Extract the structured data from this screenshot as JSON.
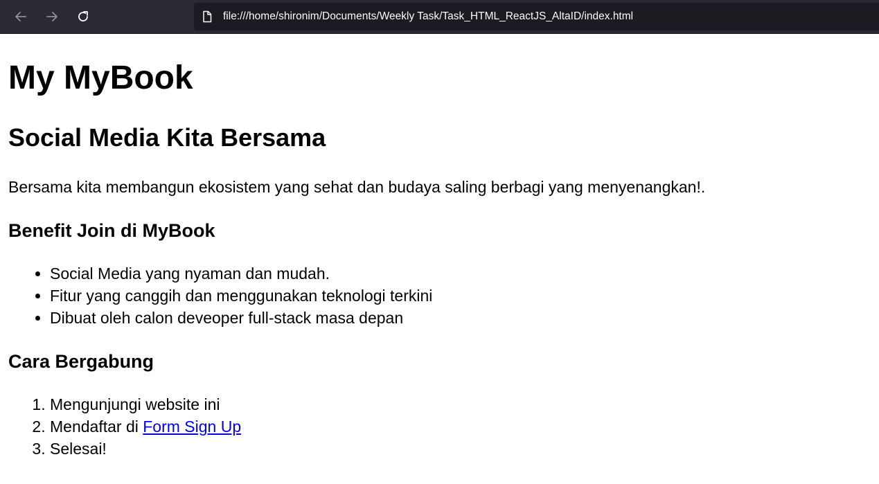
{
  "browser": {
    "url": "file:///home/shironim/Documents/Weekly Task/Task_HTML_ReactJS_AltaID/index.html",
    "icons": [
      "back-arrow-icon",
      "forward-arrow-icon",
      "reload-icon",
      "file-icon"
    ],
    "colors": {
      "toolbar_bg": "#2b2a33",
      "urlbar_bg": "#1c1b22",
      "url_text": "#fbfbfe",
      "icon_disabled": "#8f8f9d",
      "icon_enabled": "#fbfbfe"
    }
  },
  "page": {
    "title": "My MyBook",
    "tagline": "Social Media Kita Bersama",
    "intro": "Bersama kita membangun ekosistem yang sehat dan budaya saling berbagi yang menyenangkan!.",
    "benefits": {
      "heading": "Benefit Join di MyBook",
      "items": [
        "Social Media yang nyaman dan mudah.",
        "Fitur yang canggih dan menggunakan teknologi terkini",
        "Dibuat oleh calon deveoper full-stack masa depan"
      ]
    },
    "join": {
      "heading": "Cara Bergabung",
      "items": [
        {
          "text": "Mengunjungi website ini"
        },
        {
          "text": "Mendaftar di ",
          "link": "Form Sign Up"
        },
        {
          "text": "Selesai!"
        }
      ]
    },
    "link_color": "#0000ee"
  }
}
